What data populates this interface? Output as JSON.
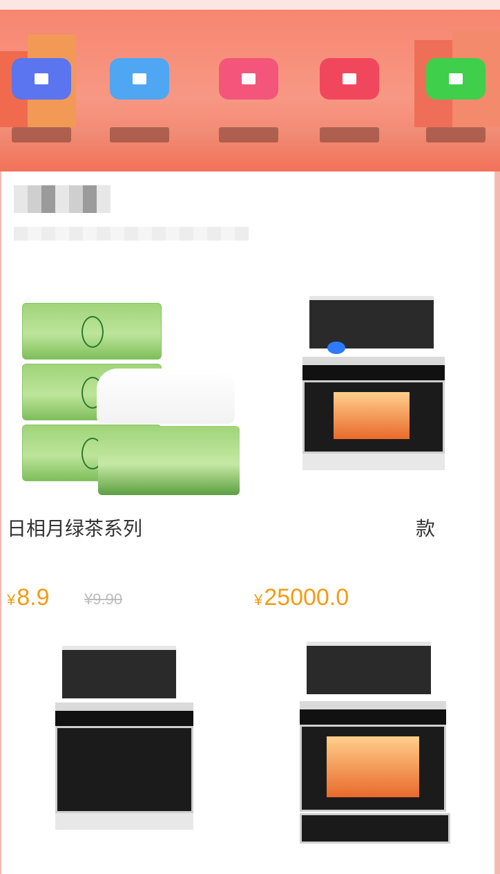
{
  "banner": {
    "categories": [
      {
        "label": "",
        "color": "#5b74ef"
      },
      {
        "label": "",
        "color": "#4fa6f3"
      },
      {
        "label": "",
        "color": "#f3567a"
      },
      {
        "label": "",
        "color": "#f1475d"
      },
      {
        "label": "",
        "color": "#3fcf4a"
      }
    ]
  },
  "section": {
    "title": "",
    "subtitle": ""
  },
  "products": [
    {
      "title": "日相月绿茶系列",
      "price_symbol": "¥",
      "price": "8.9",
      "original_price": "¥9.90"
    },
    {
      "title": "款",
      "price_symbol": "¥",
      "price": "25000.0",
      "original_price": ""
    },
    {
      "title": "",
      "price_symbol": "",
      "price": "",
      "original_price": ""
    },
    {
      "title": "",
      "price_symbol": "",
      "price": "",
      "original_price": ""
    }
  ]
}
